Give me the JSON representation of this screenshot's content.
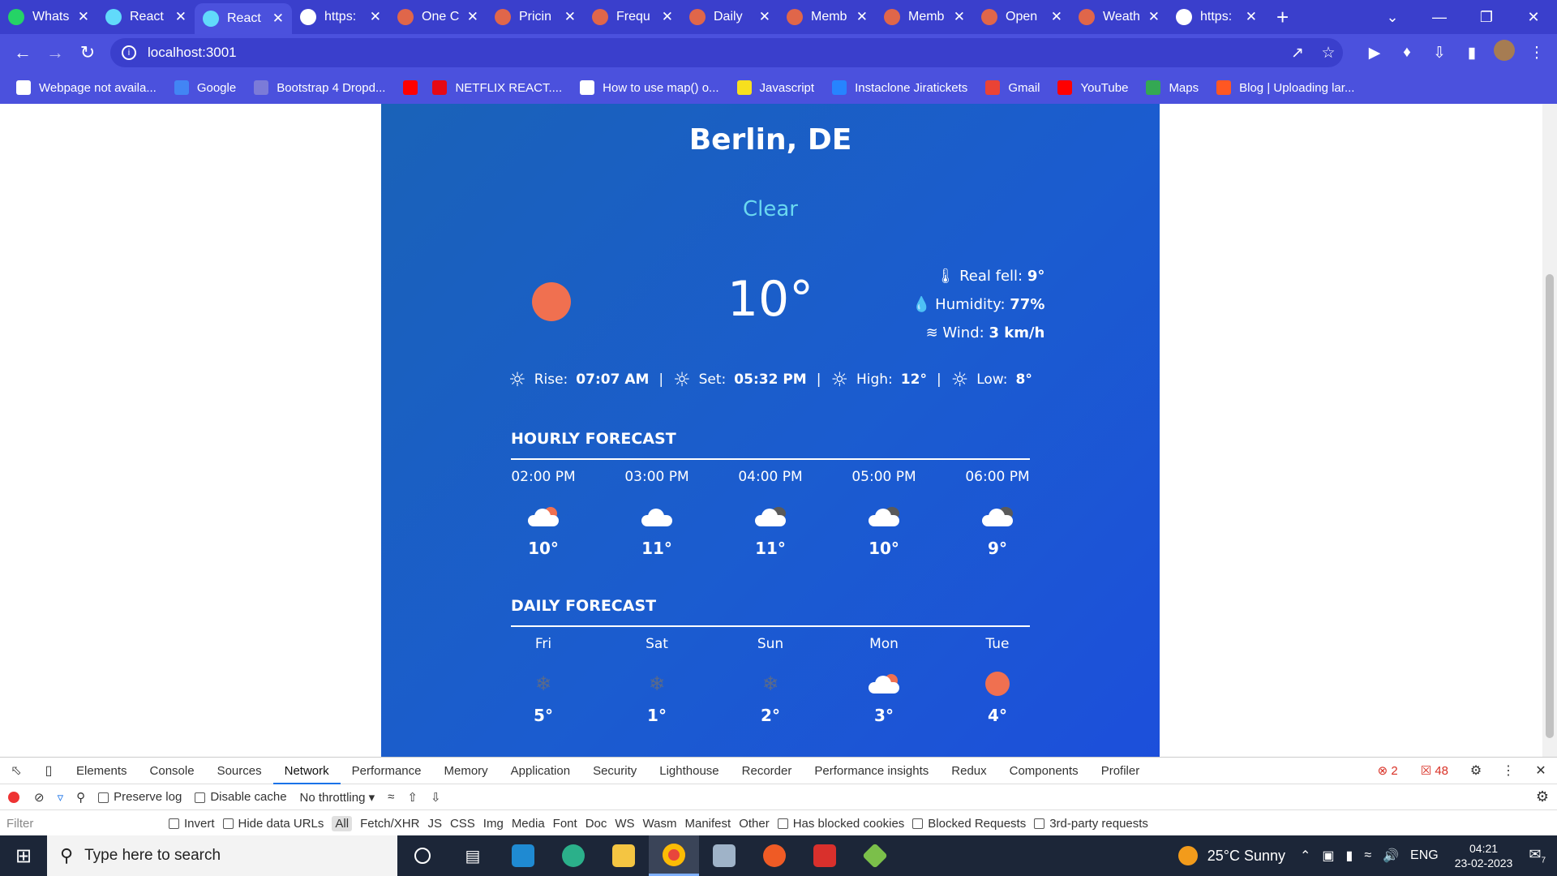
{
  "browser": {
    "tabs": [
      {
        "label": "Whats",
        "color": "#25d366"
      },
      {
        "label": "React",
        "color": "#61dafb"
      },
      {
        "label": "React",
        "color": "#61dafb",
        "active": true
      },
      {
        "label": "https:",
        "color": "#ffffff"
      },
      {
        "label": "One C",
        "color": "#e0664a"
      },
      {
        "label": "Pricin",
        "color": "#e0664a"
      },
      {
        "label": "Frequ",
        "color": "#e0664a"
      },
      {
        "label": "Daily",
        "color": "#e0664a"
      },
      {
        "label": "Memb",
        "color": "#e0664a"
      },
      {
        "label": "Memb",
        "color": "#e0664a"
      },
      {
        "label": "Open",
        "color": "#e0664a"
      },
      {
        "label": "Weath",
        "color": "#e0664a"
      },
      {
        "label": "https:",
        "color": "#ffffff"
      }
    ],
    "new_tab": "+",
    "url": "localhost:3001",
    "bookmarks": [
      {
        "label": "Webpage not availa...",
        "color": "#ffffff"
      },
      {
        "label": "Google",
        "color": "#4285f4"
      },
      {
        "label": "Bootstrap 4 Dropd...",
        "color": "#7b7bd8"
      },
      {
        "label": "",
        "color": "#ff0000"
      },
      {
        "label": "NETFLIX REACT....",
        "color": "#e50914"
      },
      {
        "label": "How to use map() o...",
        "color": "#ffffff"
      },
      {
        "label": "Javascript",
        "color": "#f7df1e"
      },
      {
        "label": "Instaclone Jiratickets",
        "color": "#2684ff"
      },
      {
        "label": "Gmail",
        "color": "#ea4335"
      },
      {
        "label": "YouTube",
        "color": "#ff0000"
      },
      {
        "label": "Maps",
        "color": "#34a853"
      },
      {
        "label": "Blog | Uploading lar...",
        "color": "#ff5722"
      }
    ]
  },
  "weather": {
    "city": "Berlin, DE",
    "condition": "Clear",
    "temperature": "10°",
    "real_feel_label": "Real fell:",
    "real_feel": "9°",
    "humidity_label": "Humidity:",
    "humidity": "77%",
    "wind_label": "Wind:",
    "wind": "3 km/h",
    "rise_label": "Rise:",
    "rise": "07:07 AM",
    "set_label": "Set:",
    "set": "05:32 PM",
    "high_label": "High:",
    "high": "12°",
    "low_label": "Low:",
    "low": "8°",
    "hourly_title": "HOURLY FORECAST",
    "hourly": [
      {
        "label": "02:00 PM",
        "temp": "10°",
        "icon": "cloud-sun"
      },
      {
        "label": "03:00 PM",
        "temp": "11°",
        "icon": "cloud"
      },
      {
        "label": "04:00 PM",
        "temp": "11°",
        "icon": "cloud-dark"
      },
      {
        "label": "05:00 PM",
        "temp": "10°",
        "icon": "cloud-dark"
      },
      {
        "label": "06:00 PM",
        "temp": "9°",
        "icon": "cloud-dark"
      }
    ],
    "daily_title": "DAILY FORECAST",
    "daily": [
      {
        "label": "Fri",
        "temp": "5°",
        "icon": "snow"
      },
      {
        "label": "Sat",
        "temp": "1°",
        "icon": "snow"
      },
      {
        "label": "Sun",
        "temp": "2°",
        "icon": "snow"
      },
      {
        "label": "Mon",
        "temp": "3°",
        "icon": "cloud-sun"
      },
      {
        "label": "Tue",
        "temp": "4°",
        "icon": "sun"
      }
    ]
  },
  "devtools": {
    "tabs": [
      "Elements",
      "Console",
      "Sources",
      "Network",
      "Performance",
      "Memory",
      "Application",
      "Security",
      "Lighthouse",
      "Recorder",
      "Performance insights",
      "Redux",
      "Components",
      "Profiler"
    ],
    "selected_tab": "Network",
    "errors": "2",
    "warnings": "48",
    "preserve_log": "Preserve log",
    "disable_cache": "Disable cache",
    "throttling": "No throttling",
    "filter_placeholder": "Filter",
    "invert": "Invert",
    "hide_data_urls": "Hide data URLs",
    "types": [
      "All",
      "Fetch/XHR",
      "JS",
      "CSS",
      "Img",
      "Media",
      "Font",
      "Doc",
      "WS",
      "Wasm",
      "Manifest",
      "Other"
    ],
    "has_blocked_cookies": "Has blocked cookies",
    "blocked_requests": "Blocked Requests",
    "third_party": "3rd-party requests"
  },
  "taskbar": {
    "search_placeholder": "Type here to search",
    "weather": "25°C  Sunny",
    "lang": "ENG",
    "time": "04:21",
    "date": "23-02-2023",
    "notifications": "7"
  }
}
